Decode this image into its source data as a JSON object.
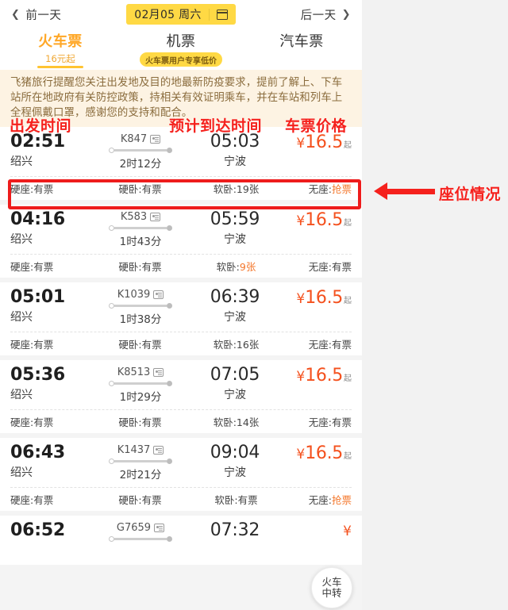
{
  "datebar": {
    "prev_label": "前一天",
    "prev_chevron": "chevron-left-icon",
    "date_text": "02月05 周六",
    "calendar_icon": "calendar-icon",
    "next_label": "后一天",
    "next_chevron": "chevron-right-icon"
  },
  "tabs": [
    {
      "title": "火车票",
      "sub": "16元起",
      "badge": "",
      "active": true
    },
    {
      "title": "机票",
      "sub": "",
      "badge": "火车票用户专享低价",
      "active": false
    },
    {
      "title": "汽车票",
      "sub": "",
      "badge": "",
      "active": false
    }
  ],
  "notice": {
    "text": "飞猪旅行提醒您关注出发地及目的地最新防疫要求，提前了解上、下车站所在地政府有关防控政策，持相关有效证明乘车，并在车站和列车上全程佩戴口罩，感谢您的支持和配合。"
  },
  "annotations": {
    "departure_time": "出发时间",
    "arrival_time": "预计到达时间",
    "ticket_price": "车票价格",
    "seat_status": "座位情况"
  },
  "trains": [
    {
      "depart_time": "02:51",
      "depart_station": "绍兴",
      "train_no": "K847",
      "duration": "2时12分",
      "arrive_time": "05:03",
      "arrive_station": "宁波",
      "currency": "¥",
      "price": "16.5",
      "price_suffix": "起",
      "seats": [
        {
          "label": "硬座:",
          "value": "有票",
          "hot": false
        },
        {
          "label": "硬卧:",
          "value": "有票",
          "hot": false
        },
        {
          "label": "软卧:",
          "value": "19张",
          "hot": false
        },
        {
          "label": "无座:",
          "value": "抢票",
          "hot": true
        }
      ]
    },
    {
      "depart_time": "04:16",
      "depart_station": "绍兴",
      "train_no": "K583",
      "duration": "1时43分",
      "arrive_time": "05:59",
      "arrive_station": "宁波",
      "currency": "¥",
      "price": "16.5",
      "price_suffix": "起",
      "seats": [
        {
          "label": "硬座:",
          "value": "有票",
          "hot": false
        },
        {
          "label": "硬卧:",
          "value": "有票",
          "hot": false
        },
        {
          "label": "软卧:",
          "value": "9张",
          "hot": true
        },
        {
          "label": "无座:",
          "value": "有票",
          "hot": false
        }
      ]
    },
    {
      "depart_time": "05:01",
      "depart_station": "绍兴",
      "train_no": "K1039",
      "duration": "1时38分",
      "arrive_time": "06:39",
      "arrive_station": "宁波",
      "currency": "¥",
      "price": "16.5",
      "price_suffix": "起",
      "seats": [
        {
          "label": "硬座:",
          "value": "有票",
          "hot": false
        },
        {
          "label": "硬卧:",
          "value": "有票",
          "hot": false
        },
        {
          "label": "软卧:",
          "value": "16张",
          "hot": false
        },
        {
          "label": "无座:",
          "value": "有票",
          "hot": false
        }
      ]
    },
    {
      "depart_time": "05:36",
      "depart_station": "绍兴",
      "train_no": "K8513",
      "duration": "1时29分",
      "arrive_time": "07:05",
      "arrive_station": "宁波",
      "currency": "¥",
      "price": "16.5",
      "price_suffix": "起",
      "seats": [
        {
          "label": "硬座:",
          "value": "有票",
          "hot": false
        },
        {
          "label": "硬卧:",
          "value": "有票",
          "hot": false
        },
        {
          "label": "软卧:",
          "value": "14张",
          "hot": false
        },
        {
          "label": "无座:",
          "value": "有票",
          "hot": false
        }
      ]
    },
    {
      "depart_time": "06:43",
      "depart_station": "绍兴",
      "train_no": "K1437",
      "duration": "2时21分",
      "arrive_time": "09:04",
      "arrive_station": "宁波",
      "currency": "¥",
      "price": "16.5",
      "price_suffix": "起",
      "seats": [
        {
          "label": "硬座:",
          "value": "有票",
          "hot": false
        },
        {
          "label": "硬卧:",
          "value": "有票",
          "hot": false
        },
        {
          "label": "软卧:",
          "value": "有票",
          "hot": false
        },
        {
          "label": "无座:",
          "value": "抢票",
          "hot": true
        }
      ]
    },
    {
      "depart_time": "06:52",
      "depart_station": "",
      "train_no": "G7659",
      "duration": "",
      "arrive_time": "07:32",
      "arrive_station": "",
      "currency": "¥",
      "price": "",
      "price_suffix": "",
      "seats": []
    }
  ],
  "fab": {
    "line1": "火车",
    "line2": "中转"
  },
  "colors": {
    "accent_yellow": "#ffd944",
    "price_orange": "#f4511e",
    "annotation_red": "#f5211d",
    "notice_bg": "#fdf3e3",
    "page_bg": "#f2f2f2"
  }
}
